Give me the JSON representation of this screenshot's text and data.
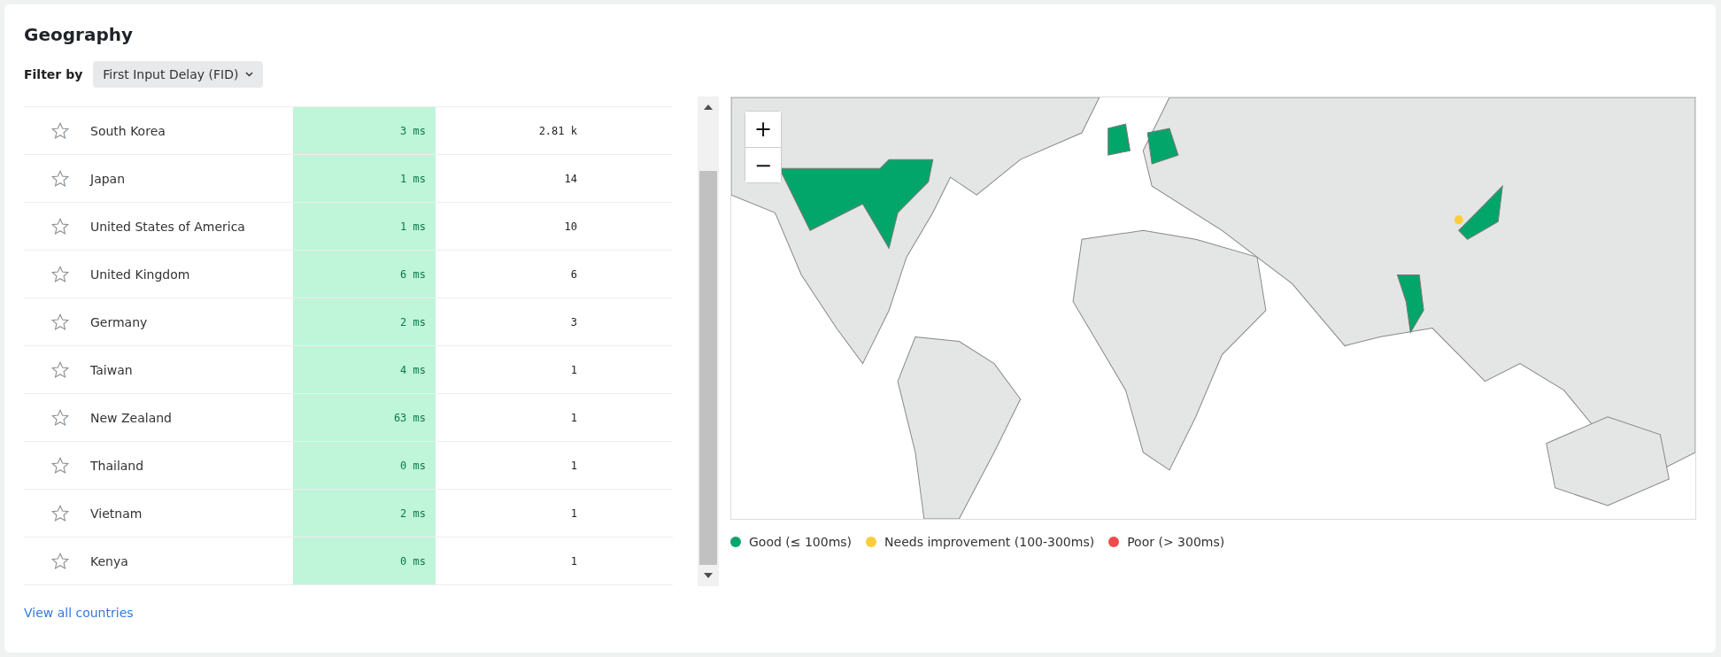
{
  "title": "Geography",
  "filter": {
    "label": "Filter by",
    "value": "First Input Delay (FID)"
  },
  "rows": [
    {
      "country": "South Korea",
      "value": "3 ms",
      "count": "2.81 k"
    },
    {
      "country": "Japan",
      "value": "1 ms",
      "count": "14"
    },
    {
      "country": "United States of America",
      "value": "1 ms",
      "count": "10"
    },
    {
      "country": "United Kingdom",
      "value": "6 ms",
      "count": "6"
    },
    {
      "country": "Germany",
      "value": "2 ms",
      "count": "3"
    },
    {
      "country": "Taiwan",
      "value": "4 ms",
      "count": "1"
    },
    {
      "country": "New Zealand",
      "value": "63 ms",
      "count": "1"
    },
    {
      "country": "Thailand",
      "value": "0 ms",
      "count": "1"
    },
    {
      "country": "Vietnam",
      "value": "2 ms",
      "count": "1"
    },
    {
      "country": "Kenya",
      "value": "0 ms",
      "count": "1"
    }
  ],
  "link": "View all countries",
  "map": {
    "zoom_in": "+",
    "zoom_out": "−"
  },
  "legend": [
    {
      "label": "Good (≤ 100ms)",
      "color": "#03a66a"
    },
    {
      "label": "Needs improvement (100-300ms)",
      "color": "#fbcd3a"
    },
    {
      "label": "Poor (> 300ms)",
      "color": "#f04b4b"
    }
  ]
}
